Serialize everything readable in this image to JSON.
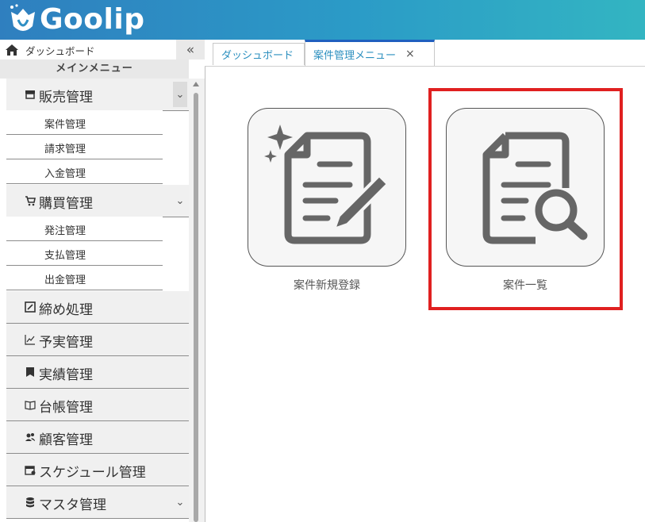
{
  "app": {
    "logo_text": "Goolip",
    "brand_color": "#2b9bc7"
  },
  "sidebar": {
    "dashboard_label": "ダッシュボード",
    "collapse_glyph": "«",
    "main_menu_title": "メインメニュー",
    "groups": [
      {
        "label": "販売管理",
        "icon": "store-icon"
      },
      {
        "label": "購買管理",
        "icon": "cart-icon"
      },
      {
        "label": "締め処理",
        "icon": "edit-box-icon"
      },
      {
        "label": "予実管理",
        "icon": "line-chart-icon"
      },
      {
        "label": "実績管理",
        "icon": "bookmark-icon"
      },
      {
        "label": "台帳管理",
        "icon": "book-icon"
      },
      {
        "label": "顧客管理",
        "icon": "users-icon"
      },
      {
        "label": "スケジュール管理",
        "icon": "calendar-icon"
      },
      {
        "label": "マスタ管理",
        "icon": "database-icon"
      }
    ],
    "sales_items": [
      "案件管理",
      "請求管理",
      "入金管理"
    ],
    "purchase_items": [
      "発注管理",
      "支払管理",
      "出金管理"
    ]
  },
  "tabs": [
    {
      "label": "ダッシュボード"
    },
    {
      "label": "案件管理メニュー",
      "close": "×"
    }
  ],
  "tiles": [
    {
      "label": "案件新規登録",
      "icon": "new-document-pencil-icon"
    },
    {
      "label": "案件一覧",
      "icon": "document-search-icon"
    }
  ],
  "highlight_color": "#e02020"
}
